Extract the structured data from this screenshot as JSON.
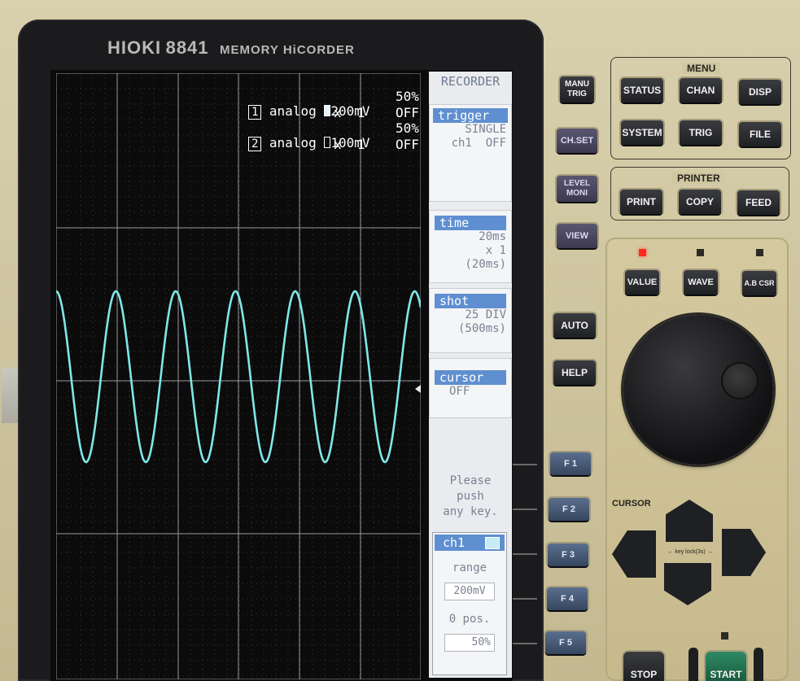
{
  "brand": {
    "maker": "HIOKI",
    "model": "8841",
    "product": "MEMORY HiCORDER"
  },
  "channels": [
    {
      "num": "1",
      "mode": "analog",
      "range": "200mV",
      "pos": "50%",
      "mult": "x  1",
      "filter": "OFF",
      "filled": true
    },
    {
      "num": "2",
      "mode": "analog",
      "range": "100mV",
      "pos": "50%",
      "mult": "x  1",
      "filter": "OFF",
      "filled": false
    }
  ],
  "waveform": {
    "marker": "1",
    "color": "#7ee8e6",
    "cycles": 6.1
  },
  "side_menu": {
    "title": "RECORDER",
    "trigger": {
      "label": "trigger",
      "line1": "SINGLE",
      "line2": "ch1  OFF"
    },
    "time": {
      "label": "time",
      "line1": "20ms",
      "line2": "x 1",
      "line3": "(20ms)"
    },
    "shot": {
      "label": "shot",
      "line1": "25 DIV",
      "line2": "(500ms)"
    },
    "cursor": {
      "label": "cursor",
      "line1": "OFF"
    },
    "prompt": [
      "Please",
      "push",
      "any key."
    ],
    "ch_panel": {
      "title": "ch1",
      "range_label": "range",
      "range_value": "200mV",
      "pos_label": "0 pos.",
      "pos_value": "50%"
    }
  },
  "left_keys": {
    "manu_trig": "MANU\nTRIG",
    "ch_set": "CH.SET",
    "level_moni": "LEVEL\nMONI",
    "view": "VIEW",
    "auto": "AUTO",
    "help": "HELP"
  },
  "menu": {
    "label": "MENU",
    "status": "STATUS",
    "chan": "CHAN",
    "disp": "DISP",
    "system": "SYSTEM",
    "trig": "TRIG",
    "file": "FILE"
  },
  "printer": {
    "label": "PRINTER",
    "print": "PRINT",
    "copy": "COPY",
    "feed": "FEED"
  },
  "mode_keys": {
    "value": "VALUE",
    "wave": "WAVE",
    "abcsr": "A.B CSR"
  },
  "fkeys": [
    "F 1",
    "F 2",
    "F 3",
    "F 4",
    "F 5"
  ],
  "cursor_pad": {
    "label": "CURSOR",
    "keylock": "key lock(3s)"
  },
  "bottom_keys": {
    "stop": "STOP",
    "start": "START"
  }
}
